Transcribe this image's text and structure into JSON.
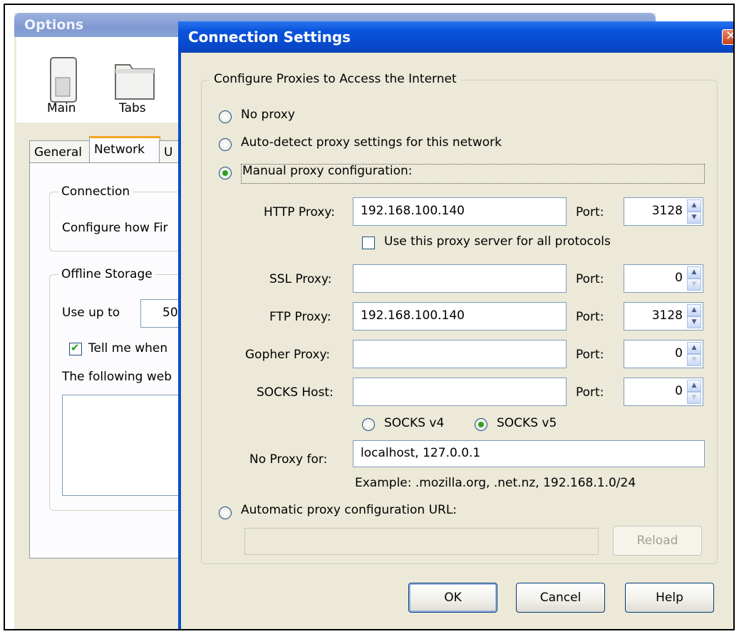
{
  "options_window": {
    "title": "Options",
    "panes": [
      "Main",
      "Tabs"
    ],
    "tabs": [
      "General",
      "Network",
      "U"
    ],
    "connection_group": "Connection",
    "connection_text": "Configure how Fir",
    "offline_group": "Offline Storage",
    "use_up_to": "Use up to",
    "use_up_to_value": "50",
    "tell_me": "Tell me when",
    "following": "The following web"
  },
  "dialog": {
    "title": "Connection Settings",
    "group_label": "Configure Proxies to Access the Internet",
    "no_proxy": "No proxy",
    "auto_detect": "Auto-detect proxy settings for this network",
    "manual": "Manual proxy configuration:",
    "http_label": "HTTP Proxy:",
    "http_value": "192.168.100.140",
    "port_label": "Port:",
    "http_port": "3128",
    "use_all": "Use this proxy server for all protocols",
    "ssl_label": "SSL Proxy:",
    "ssl_value": "",
    "ssl_port": "0",
    "ftp_label": "FTP Proxy:",
    "ftp_value": "192.168.100.140",
    "ftp_port": "3128",
    "gopher_label": "Gopher Proxy:",
    "gopher_value": "",
    "gopher_port": "0",
    "socks_label": "SOCKS Host:",
    "socks_value": "",
    "socks_port": "0",
    "socks_v4": "SOCKS v4",
    "socks_v5": "SOCKS v5",
    "no_proxy_for_label": "No Proxy for:",
    "no_proxy_for_value": "localhost, 127.0.0.1",
    "example": "Example: .mozilla.org, .net.nz, 192.168.1.0/24",
    "auto_url": "Automatic proxy configuration URL:",
    "auto_url_value": "",
    "reload": "Reload",
    "ok": "OK",
    "cancel": "Cancel",
    "help": "Help"
  }
}
